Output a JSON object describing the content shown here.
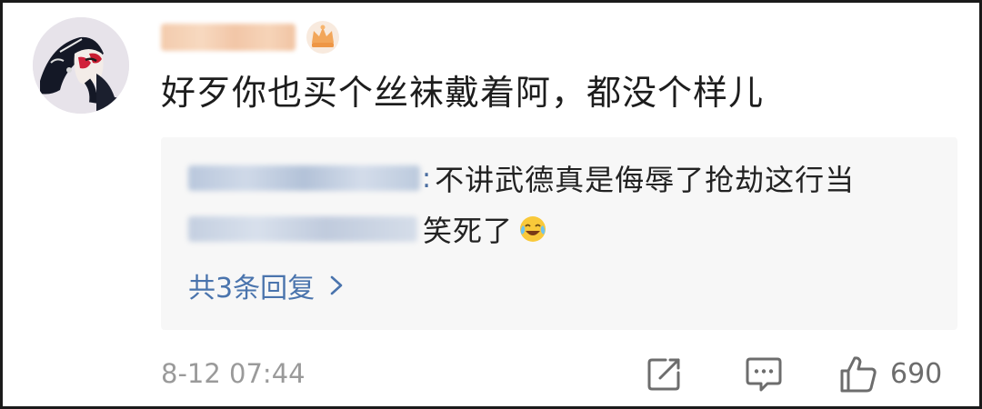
{
  "comment": {
    "text": "好歹你也买个丝袜戴着阿，都没个样儿",
    "timestamp": "8-12 07:44",
    "like_count": "690"
  },
  "replies": [
    {
      "text": "不讲武德真是侮辱了抢劫这行当"
    },
    {
      "text": "笑死了"
    }
  ],
  "more_replies_label": "共3条回复",
  "icons": {
    "user_badge": "crown-icon",
    "reply_emoji": "laughing-tears-emoji-icon",
    "more": "chevron-right-icon",
    "share": "share-icon",
    "comment": "comment-icon",
    "like": "thumbs-up-icon"
  },
  "colors": {
    "link": "#4a74ad",
    "text": "#1d1d1d",
    "muted": "#9a9a9a",
    "reply_bg": "#f7f7f7"
  }
}
